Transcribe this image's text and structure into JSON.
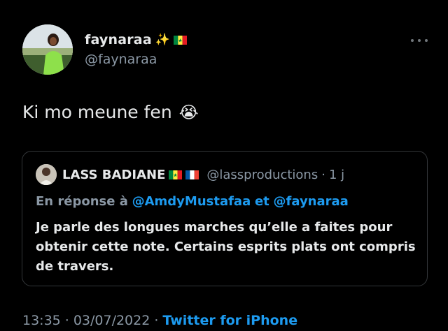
{
  "author": {
    "display_name": "faynaraa",
    "sparkle_icon": "✨",
    "handle": "@faynaraa"
  },
  "tweet": {
    "text": "Ki mo meune fen",
    "emoji": "😭"
  },
  "quote": {
    "display_name": "LASS BADIANE",
    "handle": "@lassproductions",
    "separator": "·",
    "time": "1 j",
    "reply_prefix": "En réponse à",
    "reply_mention_1": "@AmdyMustafaa",
    "reply_joiner": "et",
    "reply_mention_2": "@faynaraa",
    "text": "Je parle des longues marches qu’elle a faites pour obtenir cette note. Certains esprits plats ont compris de travers."
  },
  "meta": {
    "time": "13:35",
    "separator_1": "·",
    "date": "03/07/2022",
    "separator_2": "·",
    "source": "Twitter for iPhone"
  },
  "colors": {
    "background": "#000000",
    "text": "#e7e9ea",
    "muted": "#8b98a5",
    "link": "#1d9bf0",
    "border": "#333639"
  },
  "icons": {
    "more": "more-horizontal-icon",
    "flag_senegal": "senegal-flag-icon",
    "flag_france": "france-flag-icon"
  }
}
